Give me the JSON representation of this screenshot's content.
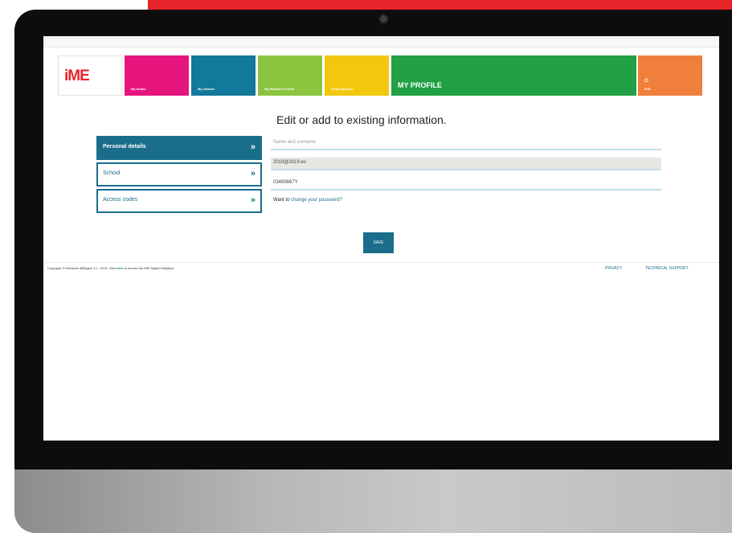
{
  "colors": {
    "red_accent": "#e8242a",
    "teal": "#1a6e8b",
    "pink": "#e6157d",
    "blue": "#12799a",
    "light_green": "#8bc53f",
    "yellow": "#f2c80f",
    "green": "#21a046",
    "orange": "#f07f3c",
    "logo_red": "#e8242a"
  },
  "nav": {
    "logo": "iME",
    "tiles": [
      {
        "label": "My books",
        "icon": "book-icon"
      },
      {
        "label": "My classes",
        "icon": "classes-icon"
      },
      {
        "label": "My Student records",
        "icon": "records-icon"
      },
      {
        "label": "Offline access",
        "icon": "offline-icon"
      }
    ],
    "profile_label": "MY PROFILE",
    "exit_label": "Exit",
    "exit_icon": "power-icon"
  },
  "heading": "Edit or add to existing information.",
  "menu": {
    "items": [
      {
        "label": "Personal details",
        "active": true
      },
      {
        "label": "School",
        "active": false
      },
      {
        "label": "Access codes",
        "active": false
      }
    ],
    "chevron": "»"
  },
  "form": {
    "name_placeholder": "Name and surname",
    "email_value": "2019@2019.es",
    "code_value": "03489867Y",
    "password_prompt": "Want to",
    "password_link": "change your password?"
  },
  "save_label": "SAVE",
  "footer": {
    "copyright_pre": "Copyright © Ediciones Billingüe S.L. 2019. Click ",
    "copyright_link": "here",
    "copyright_post": " to access the iME Digital Helpdesk.",
    "privacy": "PRIVACY",
    "support": "TECHNICAL SUPPORT"
  }
}
